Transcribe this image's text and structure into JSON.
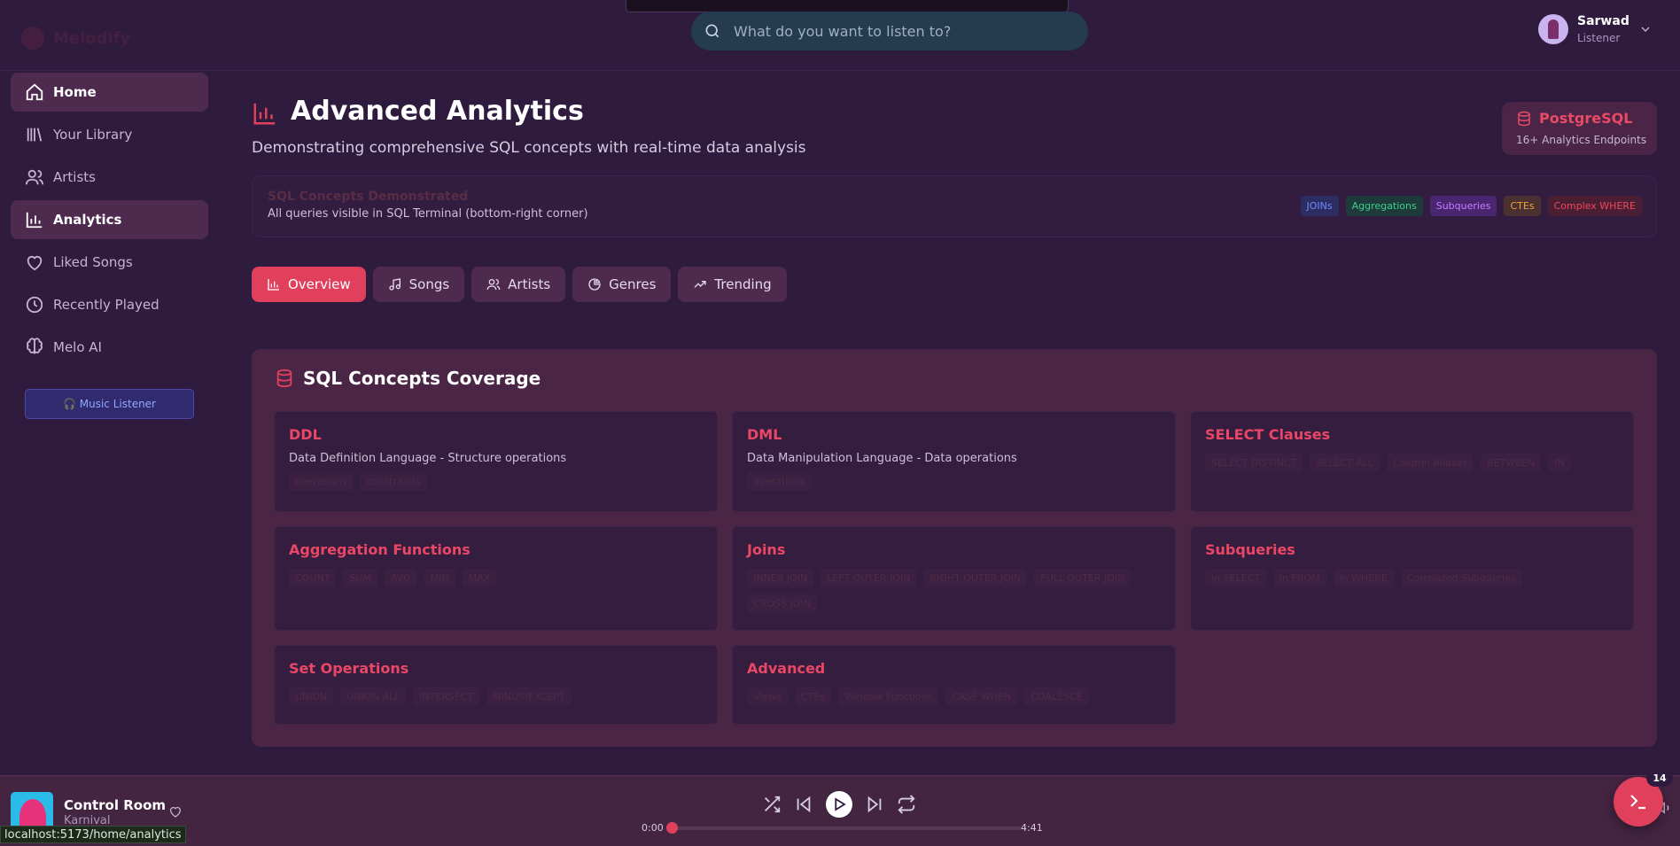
{
  "app": {
    "logo_text": "Melodify"
  },
  "search": {
    "placeholder": "What do you want to listen to?"
  },
  "user": {
    "name": "Sarwad",
    "role": "Listener"
  },
  "sidebar": {
    "items": [
      {
        "label": "Home",
        "icon": "home-icon",
        "active": true
      },
      {
        "label": "Your Library",
        "icon": "library-icon",
        "active": false
      },
      {
        "label": "Artists",
        "icon": "users-icon",
        "active": false
      },
      {
        "label": "Analytics",
        "icon": "bar-chart-icon",
        "active": true
      },
      {
        "label": "Liked Songs",
        "icon": "heart-icon",
        "active": false
      },
      {
        "label": "Recently Played",
        "icon": "clock-icon",
        "active": false
      },
      {
        "label": "Melo AI",
        "icon": "brain-icon",
        "active": false
      }
    ],
    "role_button": "🎧 Music Listener"
  },
  "page": {
    "title": "Advanced Analytics",
    "subtitle": "Demonstrating comprehensive SQL concepts with real-time data analysis",
    "db_card": {
      "title": "PostgreSQL",
      "subtitle": "16+ Analytics Endpoints"
    }
  },
  "concepts_banner": {
    "title": "SQL Concepts Demonstrated",
    "subtitle": "All queries visible in SQL Terminal (bottom-right corner)",
    "badges": [
      {
        "label": "JOINs",
        "color": "#6f8cff",
        "bg": "#2d2c63"
      },
      {
        "label": "Aggregations",
        "color": "#3ed08a",
        "bg": "#1f3a3a"
      },
      {
        "label": "Subqueries",
        "color": "#c77dff",
        "bg": "#4a2670"
      },
      {
        "label": "CTEs",
        "color": "#f0a23a",
        "bg": "#4a3030"
      },
      {
        "label": "Complex WHERE",
        "color": "#f0465c",
        "bg": "#4a1f33"
      }
    ]
  },
  "tabs": [
    {
      "label": "Overview",
      "icon": "bar-chart-icon",
      "active": true
    },
    {
      "label": "Songs",
      "icon": "music-note-icon",
      "active": false
    },
    {
      "label": "Artists",
      "icon": "users-icon",
      "active": false
    },
    {
      "label": "Genres",
      "icon": "pie-chart-icon",
      "active": false
    },
    {
      "label": "Trending",
      "icon": "trending-up-icon",
      "active": false
    }
  ],
  "coverage": {
    "title": "SQL Concepts Coverage",
    "cards": [
      {
        "title": "DDL",
        "description": "Data Definition Language - Structure operations",
        "tags": [
          "operations",
          "constraints"
        ]
      },
      {
        "title": "DML",
        "description": "Data Manipulation Language - Data operations",
        "tags": [
          "operations"
        ]
      },
      {
        "title": "SELECT Clauses",
        "description": "",
        "tags": [
          "SELECT DISTINCT",
          "SELECT ALL",
          "Column Aliases",
          "BETWEEN",
          "IN"
        ]
      },
      {
        "title": "Aggregation Functions",
        "description": "",
        "tags": [
          "COUNT",
          "SUM",
          "AVG",
          "MIN",
          "MAX"
        ]
      },
      {
        "title": "Joins",
        "description": "",
        "tags": [
          "INNER JOIN",
          "LEFT OUTER JOIN",
          "RIGHT OUTER JOIN",
          "FULL OUTER JOIN",
          "CROSS JOIN"
        ]
      },
      {
        "title": "Subqueries",
        "description": "",
        "tags": [
          "in SELECT",
          "in FROM",
          "in WHERE",
          "Correlated Subqueries"
        ]
      },
      {
        "title": "Set Operations",
        "description": "",
        "tags": [
          "UNION",
          "UNION ALL",
          "INTERSECT",
          "MINUS/EXCEPT"
        ]
      },
      {
        "title": "Advanced",
        "description": "",
        "tags": [
          "Views",
          "CTEs",
          "Window Functions",
          "CASE WHEN",
          "COALESCE"
        ]
      }
    ]
  },
  "player": {
    "title": "Control Room",
    "artist": "Karnival",
    "current_time": "0:00",
    "total_time": "4:41",
    "progress": 0
  },
  "terminal": {
    "badge_count": "14"
  },
  "statusbar": {
    "url": "localhost:5173/home/analytics"
  }
}
